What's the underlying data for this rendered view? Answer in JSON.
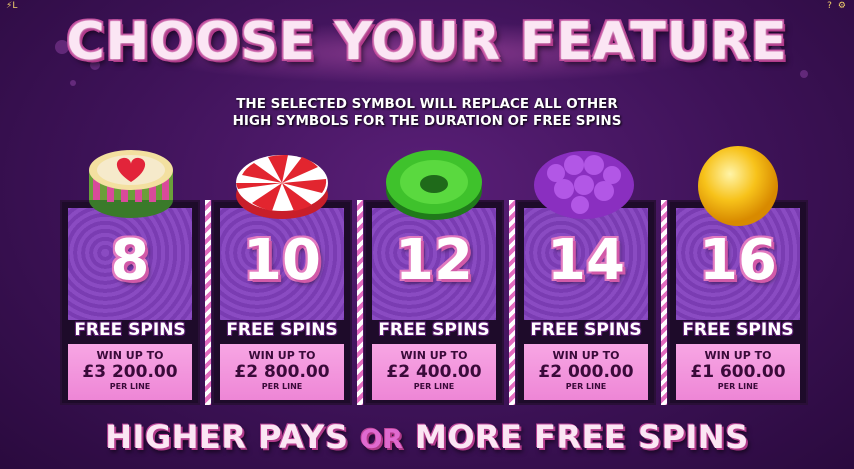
{
  "header": {
    "left_indicator": "⚡L",
    "right_help": "?",
    "right_icon": "settings-icon"
  },
  "title": "CHOOSE YOUR FEATURE",
  "subtitle_line1": "THE SELECTED SYMBOL WILL REPLACE ALL OTHER",
  "subtitle_line2": "HIGH SYMBOLS FOR THE DURATION OF FREE SPINS",
  "features": [
    {
      "symbol": "heart-candy-icon",
      "spins": "8",
      "label": "FREE SPINS",
      "win_up_to": "WIN UP TO",
      "amount": "£3 200.00",
      "per_line": "PER LINE"
    },
    {
      "symbol": "peppermint-swirl-icon",
      "spins": "10",
      "label": "FREE SPINS",
      "win_up_to": "WIN UP TO",
      "amount": "£2 800.00",
      "per_line": "PER LINE"
    },
    {
      "symbol": "green-sweet-ring-icon",
      "spins": "12",
      "label": "FREE SPINS",
      "win_up_to": "WIN UP TO",
      "amount": "£2 400.00",
      "per_line": "PER LINE"
    },
    {
      "symbol": "purple-raspberry-candy-icon",
      "spins": "14",
      "label": "FREE SPINS",
      "win_up_to": "WIN UP TO",
      "amount": "£2 000.00",
      "per_line": "PER LINE"
    },
    {
      "symbol": "yellow-lollipop-icon",
      "spins": "16",
      "label": "FREE SPINS",
      "win_up_to": "WIN UP TO",
      "amount": "£1 600.00",
      "per_line": "PER LINE"
    }
  ],
  "footer": {
    "part1": "HIGHER PAYS",
    "or": "OR",
    "part2": "MORE FREE SPINS"
  },
  "colors": {
    "background": "#3d1257",
    "accent_pink": "#ee86d6",
    "title_text": "#fbe6f4"
  }
}
